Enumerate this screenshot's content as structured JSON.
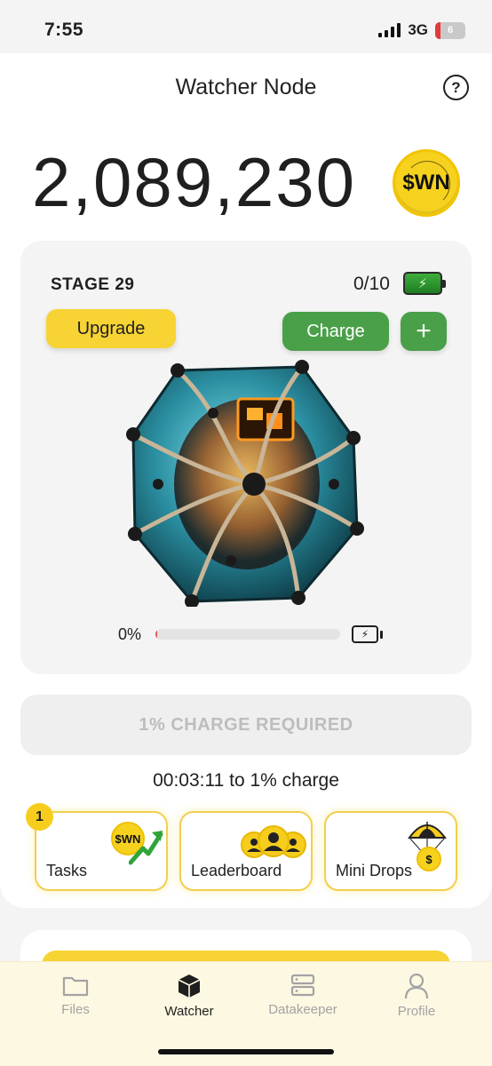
{
  "status_bar": {
    "time": "7:55",
    "network": "3G",
    "battery": "6"
  },
  "header": {
    "title": "Watcher Node",
    "help_icon": "?"
  },
  "balance": {
    "amount": "2,089,230",
    "token": "$WN"
  },
  "stage_card": {
    "stage_label": "STAGE 29",
    "charges": "0/10",
    "upgrade_label": "Upgrade",
    "charge_label": "Charge",
    "plus_label": "+",
    "progress_percent_text": "0%",
    "progress_value": 0.01
  },
  "charge_required_label": "1% CHARGE REQUIRED",
  "countdown": "00:03:11 to 1% charge",
  "tiles": [
    {
      "label": "Tasks",
      "badge": "1",
      "icon": "wn-coin-trend-icon",
      "coin_text": "$WN"
    },
    {
      "label": "Leaderboard",
      "icon": "leaderboard-people-icon"
    },
    {
      "label": "Mini Drops",
      "icon": "parachute-coin-icon",
      "coin_text": "$"
    }
  ],
  "tab_bar": [
    {
      "label": "Files",
      "icon": "folder-icon",
      "active": false
    },
    {
      "label": "Watcher",
      "icon": "cube-icon",
      "active": true
    },
    {
      "label": "Datakeeper",
      "icon": "server-icon",
      "active": false
    },
    {
      "label": "Profile",
      "icon": "person-icon",
      "active": false
    }
  ],
  "colors": {
    "accent_yellow": "#f7d334",
    "accent_green": "#4aa048",
    "card_bg": "#f4f4f4"
  }
}
